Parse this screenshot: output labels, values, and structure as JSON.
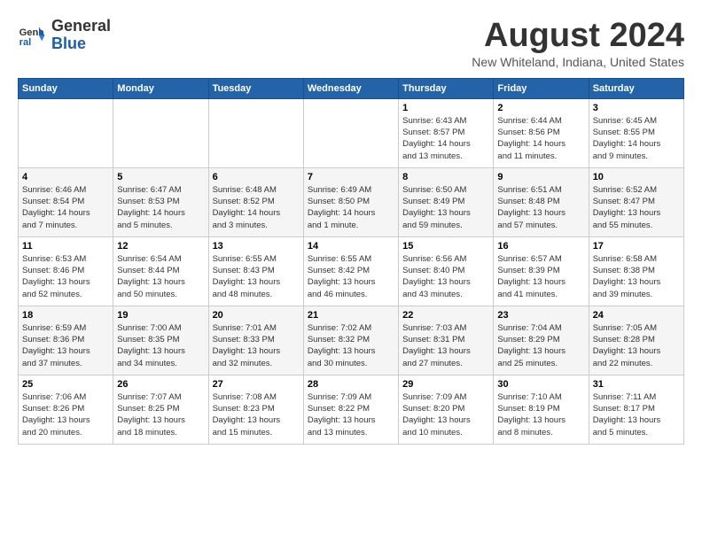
{
  "logo": {
    "line1": "General",
    "line2": "Blue"
  },
  "title": "August 2024",
  "subtitle": "New Whiteland, Indiana, United States",
  "days_of_week": [
    "Sunday",
    "Monday",
    "Tuesday",
    "Wednesday",
    "Thursday",
    "Friday",
    "Saturday"
  ],
  "weeks": [
    [
      {
        "num": "",
        "info": ""
      },
      {
        "num": "",
        "info": ""
      },
      {
        "num": "",
        "info": ""
      },
      {
        "num": "",
        "info": ""
      },
      {
        "num": "1",
        "info": "Sunrise: 6:43 AM\nSunset: 8:57 PM\nDaylight: 14 hours\nand 13 minutes."
      },
      {
        "num": "2",
        "info": "Sunrise: 6:44 AM\nSunset: 8:56 PM\nDaylight: 14 hours\nand 11 minutes."
      },
      {
        "num": "3",
        "info": "Sunrise: 6:45 AM\nSunset: 8:55 PM\nDaylight: 14 hours\nand 9 minutes."
      }
    ],
    [
      {
        "num": "4",
        "info": "Sunrise: 6:46 AM\nSunset: 8:54 PM\nDaylight: 14 hours\nand 7 minutes."
      },
      {
        "num": "5",
        "info": "Sunrise: 6:47 AM\nSunset: 8:53 PM\nDaylight: 14 hours\nand 5 minutes."
      },
      {
        "num": "6",
        "info": "Sunrise: 6:48 AM\nSunset: 8:52 PM\nDaylight: 14 hours\nand 3 minutes."
      },
      {
        "num": "7",
        "info": "Sunrise: 6:49 AM\nSunset: 8:50 PM\nDaylight: 14 hours\nand 1 minute."
      },
      {
        "num": "8",
        "info": "Sunrise: 6:50 AM\nSunset: 8:49 PM\nDaylight: 13 hours\nand 59 minutes."
      },
      {
        "num": "9",
        "info": "Sunrise: 6:51 AM\nSunset: 8:48 PM\nDaylight: 13 hours\nand 57 minutes."
      },
      {
        "num": "10",
        "info": "Sunrise: 6:52 AM\nSunset: 8:47 PM\nDaylight: 13 hours\nand 55 minutes."
      }
    ],
    [
      {
        "num": "11",
        "info": "Sunrise: 6:53 AM\nSunset: 8:46 PM\nDaylight: 13 hours\nand 52 minutes."
      },
      {
        "num": "12",
        "info": "Sunrise: 6:54 AM\nSunset: 8:44 PM\nDaylight: 13 hours\nand 50 minutes."
      },
      {
        "num": "13",
        "info": "Sunrise: 6:55 AM\nSunset: 8:43 PM\nDaylight: 13 hours\nand 48 minutes."
      },
      {
        "num": "14",
        "info": "Sunrise: 6:55 AM\nSunset: 8:42 PM\nDaylight: 13 hours\nand 46 minutes."
      },
      {
        "num": "15",
        "info": "Sunrise: 6:56 AM\nSunset: 8:40 PM\nDaylight: 13 hours\nand 43 minutes."
      },
      {
        "num": "16",
        "info": "Sunrise: 6:57 AM\nSunset: 8:39 PM\nDaylight: 13 hours\nand 41 minutes."
      },
      {
        "num": "17",
        "info": "Sunrise: 6:58 AM\nSunset: 8:38 PM\nDaylight: 13 hours\nand 39 minutes."
      }
    ],
    [
      {
        "num": "18",
        "info": "Sunrise: 6:59 AM\nSunset: 8:36 PM\nDaylight: 13 hours\nand 37 minutes."
      },
      {
        "num": "19",
        "info": "Sunrise: 7:00 AM\nSunset: 8:35 PM\nDaylight: 13 hours\nand 34 minutes."
      },
      {
        "num": "20",
        "info": "Sunrise: 7:01 AM\nSunset: 8:33 PM\nDaylight: 13 hours\nand 32 minutes."
      },
      {
        "num": "21",
        "info": "Sunrise: 7:02 AM\nSunset: 8:32 PM\nDaylight: 13 hours\nand 30 minutes."
      },
      {
        "num": "22",
        "info": "Sunrise: 7:03 AM\nSunset: 8:31 PM\nDaylight: 13 hours\nand 27 minutes."
      },
      {
        "num": "23",
        "info": "Sunrise: 7:04 AM\nSunset: 8:29 PM\nDaylight: 13 hours\nand 25 minutes."
      },
      {
        "num": "24",
        "info": "Sunrise: 7:05 AM\nSunset: 8:28 PM\nDaylight: 13 hours\nand 22 minutes."
      }
    ],
    [
      {
        "num": "25",
        "info": "Sunrise: 7:06 AM\nSunset: 8:26 PM\nDaylight: 13 hours\nand 20 minutes."
      },
      {
        "num": "26",
        "info": "Sunrise: 7:07 AM\nSunset: 8:25 PM\nDaylight: 13 hours\nand 18 minutes."
      },
      {
        "num": "27",
        "info": "Sunrise: 7:08 AM\nSunset: 8:23 PM\nDaylight: 13 hours\nand 15 minutes."
      },
      {
        "num": "28",
        "info": "Sunrise: 7:09 AM\nSunset: 8:22 PM\nDaylight: 13 hours\nand 13 minutes."
      },
      {
        "num": "29",
        "info": "Sunrise: 7:09 AM\nSunset: 8:20 PM\nDaylight: 13 hours\nand 10 minutes."
      },
      {
        "num": "30",
        "info": "Sunrise: 7:10 AM\nSunset: 8:19 PM\nDaylight: 13 hours\nand 8 minutes."
      },
      {
        "num": "31",
        "info": "Sunrise: 7:11 AM\nSunset: 8:17 PM\nDaylight: 13 hours\nand 5 minutes."
      }
    ]
  ]
}
